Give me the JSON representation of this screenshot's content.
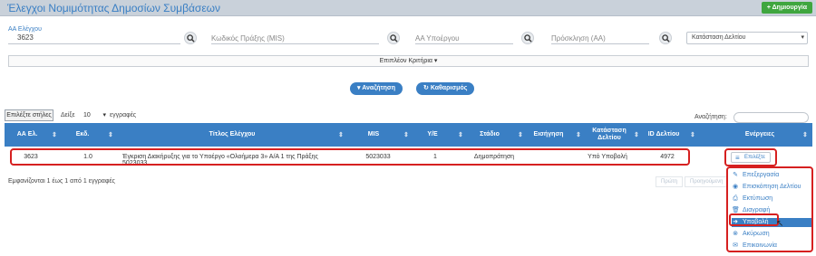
{
  "app": {
    "title": "Έλεγχοι Νομιμότητας Δημοσίων Συμβάσεων",
    "new_button": "Δημιουργία"
  },
  "filters": {
    "aa_label": "ΑΑ Ελέγχου",
    "aa_value": "3623",
    "mis_placeholder": "Κωδικός Πράξης (MIS)",
    "subproject_placeholder": "ΑΑ Υποέργου",
    "invitation_placeholder": "Πρόσκληση (ΑΑ)",
    "status_select": "Κατάσταση Δελτίου",
    "criteria": "Επιπλέον Κριτήρια ▾"
  },
  "actions": {
    "search": "Αναζήτηση",
    "clear": "Καθαρισμός"
  },
  "table_controls": {
    "choose_columns": "Επιλέξτε στήλες",
    "show": "Δείξε",
    "page_size": "10",
    "entries": "εγγραφές",
    "search_label": "Αναζήτηση:"
  },
  "table": {
    "headers": [
      "ΑΑ Ελ.",
      "Εκδ.",
      "Τίτλος Ελέγχου",
      "MIS",
      "Υ/Ε",
      "Στάδιο",
      "Εισήγηση",
      "Κατάσταση Δελτίου",
      "ID Δελτίου",
      "Ενέργειες"
    ],
    "rows": [
      {
        "aa": "3623",
        "version": "1.0",
        "title": "Έγκριση Διακήρυξης για το Υποέργο «Ολοήμερα 3» Α/Α 1 της Πράξης 5023033",
        "mis": "5023033",
        "subproject": "1",
        "stage": "Δημοπράτηση",
        "recommendation": "",
        "status": "Υπό Υποβολή",
        "id": "4972",
        "action": "Επιλέξτε"
      }
    ]
  },
  "footer": {
    "info": "Εμφανίζονται 1 έως 1 από 1 εγγραφές",
    "first": "Πρώτη",
    "previous": "Προηγούμενη"
  },
  "menu": [
    {
      "label": "Επεξεργασία",
      "icon": "edit-icon"
    },
    {
      "label": "Επισκόπηση Δελτίου",
      "icon": "eye-icon"
    },
    {
      "label": "Εκτύπωση",
      "icon": "print-icon"
    },
    {
      "label": "Διαγραφή",
      "icon": "trash-icon"
    },
    {
      "label": "Υποβολή",
      "icon": "submit-icon"
    },
    {
      "label": "Ακύρωση",
      "icon": "cancel-icon"
    },
    {
      "label": "Επικοινωνία",
      "icon": "mail-icon"
    }
  ],
  "colors": {
    "accent": "#3a7fc4",
    "highlight": "#d62020",
    "success": "#3fa63f"
  }
}
